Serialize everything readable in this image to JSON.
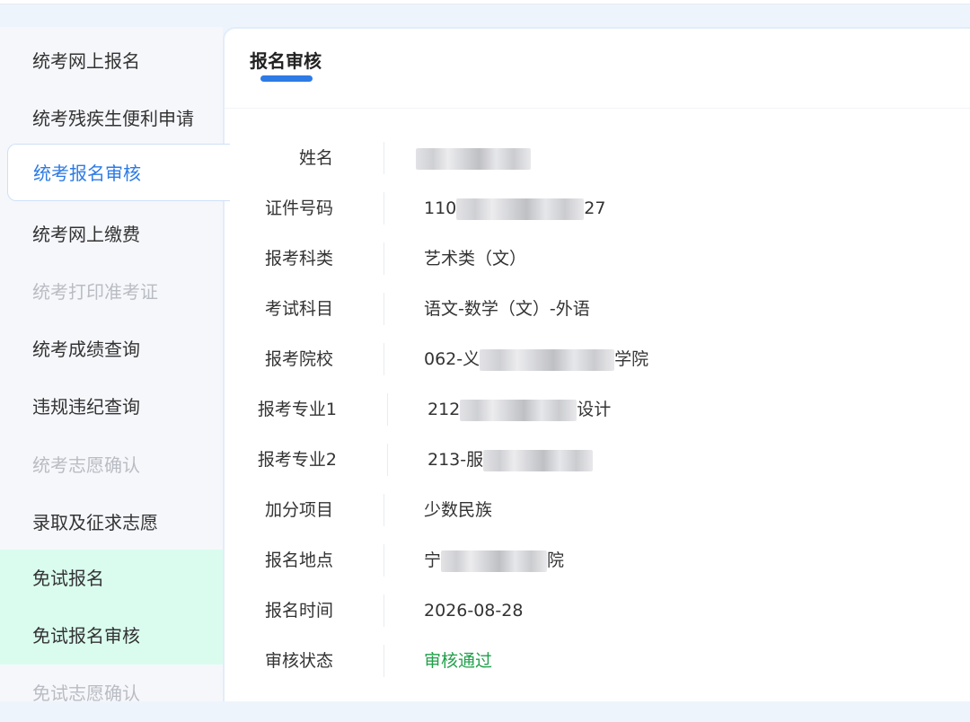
{
  "sidebar": {
    "items": [
      {
        "label": "统考网上报名"
      },
      {
        "label": "统考残疾生便利申请"
      },
      {
        "label": "统考报名审核"
      },
      {
        "label": "统考网上缴费"
      },
      {
        "label": "统考打印准考证"
      },
      {
        "label": "统考成绩查询"
      },
      {
        "label": "违规违纪查询"
      },
      {
        "label": "统考志愿确认"
      },
      {
        "label": "录取及征求志愿"
      },
      {
        "label": "免试报名"
      },
      {
        "label": "免试报名审核"
      },
      {
        "label": "免试志愿确认"
      }
    ]
  },
  "main": {
    "tab_title": "报名审核",
    "fields": [
      {
        "label": "姓名",
        "pre": "",
        "post": ""
      },
      {
        "label": "证件号码",
        "pre": "110",
        "post": "27"
      },
      {
        "label": "报考科类",
        "pre": "艺术类（文）",
        "post": ""
      },
      {
        "label": "考试科目",
        "pre": "语文-数学（文）-外语",
        "post": ""
      },
      {
        "label": "报考院校",
        "pre": "062-义",
        "post": "学院"
      },
      {
        "label": "报考专业1",
        "pre": "212",
        "post": "设计"
      },
      {
        "label": "报考专业2",
        "pre": "213-服",
        "post": ""
      },
      {
        "label": "加分项目",
        "pre": "少数民族",
        "post": ""
      },
      {
        "label": "报名地点",
        "pre": "宁",
        "post": "院"
      },
      {
        "label": "报名时间",
        "pre": "2026-08-28",
        "post": ""
      },
      {
        "label": "审核状态",
        "pre": "审核通过",
        "post": ""
      }
    ]
  },
  "colors": {
    "accent": "#2d7be5",
    "status_ok": "#20a04a",
    "disabled_text": "#b9bcc3",
    "highlight_bg": "#dafcef"
  }
}
